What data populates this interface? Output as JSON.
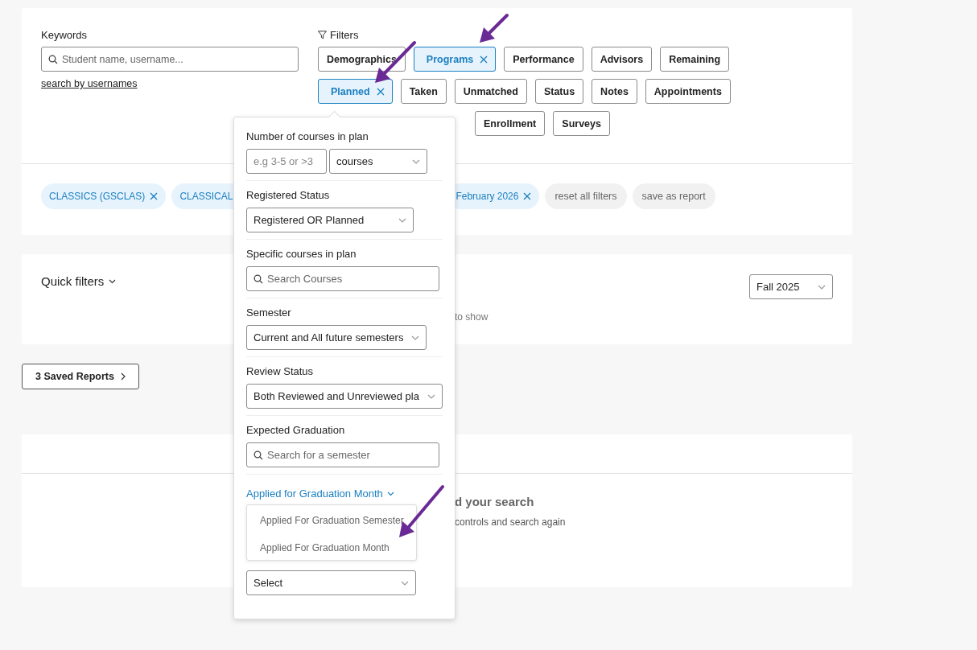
{
  "keywords": {
    "label": "Keywords",
    "placeholder": "Student name, username...",
    "link": "search by usernames"
  },
  "filters": {
    "label": "Filters",
    "tabs": [
      {
        "label": "Demographics",
        "selected": false
      },
      {
        "label": "Programs",
        "selected": true
      },
      {
        "label": "Performance",
        "selected": false
      },
      {
        "label": "Advisors",
        "selected": false
      },
      {
        "label": "Remaining",
        "selected": false
      },
      {
        "label": "Planned",
        "selected": true
      },
      {
        "label": "Taken",
        "selected": false
      },
      {
        "label": "Unmatched",
        "selected": false
      },
      {
        "label": "Status",
        "selected": false
      },
      {
        "label": "Notes",
        "selected": false
      },
      {
        "label": "Appointments",
        "selected": false
      },
      {
        "label": "Enrollment",
        "selected": false
      },
      {
        "label": "Surveys",
        "selected": false
      }
    ]
  },
  "active_filters": [
    {
      "label": "CLASSICS (GSCLAS)",
      "removable": true
    },
    {
      "label": "CLASSICAL",
      "removable": false
    },
    {
      "label": "February 2026",
      "removable": true
    }
  ],
  "filter_actions": [
    "reset all filters",
    "save as report"
  ],
  "quick_filters": {
    "label": "Quick filters",
    "note": "to show",
    "semester": "Fall 2025"
  },
  "saved_reports": "3 Saved Reports",
  "results": {
    "title": "d your search",
    "hint": "controls and search again"
  },
  "planned_popup": {
    "sections": [
      {
        "kind": "range",
        "label": "Number of courses in plan",
        "placeholder": "e.g 3-5 or >3",
        "unit": "courses"
      },
      {
        "kind": "select",
        "label": "Registered Status",
        "value": "Registered OR Planned"
      },
      {
        "kind": "search",
        "label": "Specific courses in plan",
        "placeholder": "Search Courses"
      },
      {
        "kind": "select",
        "label": "Semester",
        "value": "Current and All future semesters"
      },
      {
        "kind": "select",
        "label": "Review Status",
        "value": "Both Reviewed and Unreviewed pla"
      },
      {
        "kind": "search",
        "label": "Expected Graduation",
        "placeholder": "Search for a semester"
      },
      {
        "kind": "expander",
        "label": "Applied for Graduation Month",
        "expanded": true,
        "options": [
          "Applied For Graduation Semester",
          "Applied For Graduation Month"
        ],
        "value": "Select"
      }
    ]
  }
}
